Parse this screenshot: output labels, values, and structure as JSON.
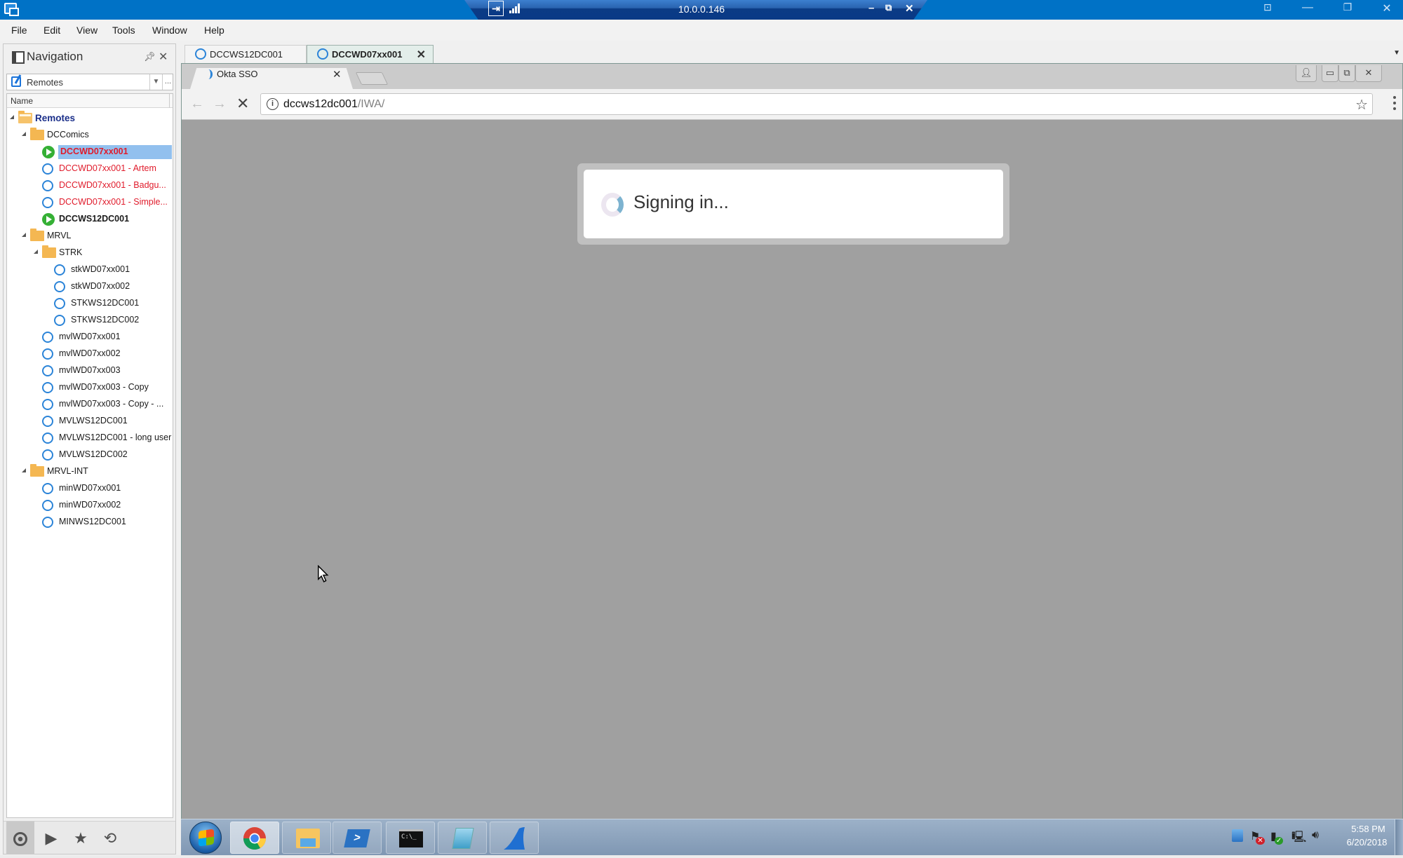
{
  "remote_bar": {
    "host": "10.0.0.146"
  },
  "menu": {
    "items": [
      "File",
      "Edit",
      "View",
      "Tools",
      "Window",
      "Help"
    ]
  },
  "navigation": {
    "title": "Navigation",
    "selector": {
      "value": "Remotes",
      "more_label": "..."
    },
    "column_header": "Name",
    "tree": [
      {
        "level": 0,
        "type": "folder",
        "label": "Remotes",
        "expanded": true,
        "style": "root"
      },
      {
        "level": 1,
        "type": "folder",
        "label": "DCComics",
        "expanded": true
      },
      {
        "level": 2,
        "type": "connected",
        "label": "DCCWD07xx001",
        "style": "red-bold",
        "selected": true
      },
      {
        "level": 2,
        "type": "remote",
        "label": "DCCWD07xx001 - Artem",
        "style": "red"
      },
      {
        "level": 2,
        "type": "remote",
        "label": "DCCWD07xx001 - Badgu...",
        "style": "red"
      },
      {
        "level": 2,
        "type": "remote",
        "label": "DCCWD07xx001 - Simple...",
        "style": "red"
      },
      {
        "level": 2,
        "type": "connected",
        "label": "DCCWS12DC001",
        "style": "bold"
      },
      {
        "level": 1,
        "type": "folder",
        "label": "MRVL",
        "expanded": true
      },
      {
        "level": 2,
        "type": "folder",
        "label": "STRK",
        "expanded": true
      },
      {
        "level": 3,
        "type": "remote",
        "label": "stkWD07xx001"
      },
      {
        "level": 3,
        "type": "remote",
        "label": "stkWD07xx002"
      },
      {
        "level": 3,
        "type": "remote",
        "label": "STKWS12DC001"
      },
      {
        "level": 3,
        "type": "remote",
        "label": "STKWS12DC002"
      },
      {
        "level": 2,
        "type": "remote",
        "label": "mvlWD07xx001"
      },
      {
        "level": 2,
        "type": "remote",
        "label": "mvlWD07xx002"
      },
      {
        "level": 2,
        "type": "remote",
        "label": "mvlWD07xx003"
      },
      {
        "level": 2,
        "type": "remote",
        "label": "mvlWD07xx003 - Copy"
      },
      {
        "level": 2,
        "type": "remote",
        "label": "mvlWD07xx003 - Copy - ..."
      },
      {
        "level": 2,
        "type": "remote",
        "label": "MVLWS12DC001"
      },
      {
        "level": 2,
        "type": "remote",
        "label": "MVLWS12DC001 - long user"
      },
      {
        "level": 2,
        "type": "remote",
        "label": "MVLWS12DC002"
      },
      {
        "level": 1,
        "type": "folder",
        "label": "MRVL-INT",
        "expanded": true
      },
      {
        "level": 2,
        "type": "remote",
        "label": "minWD07xx001"
      },
      {
        "level": 2,
        "type": "remote",
        "label": "minWD07xx002"
      },
      {
        "level": 2,
        "type": "remote",
        "label": "MINWS12DC001"
      }
    ],
    "footer_buttons": [
      "record-icon",
      "play-icon",
      "star-icon",
      "history-icon"
    ]
  },
  "document_tabs": [
    {
      "label": "DCCWS12DC001",
      "active": false
    },
    {
      "label": "DCCWD07xx001",
      "active": true,
      "close": "✕"
    }
  ],
  "browser": {
    "tab_title": "Okta SSO",
    "tab_close": "✕",
    "url_host": "dccws12dc001",
    "url_path": "/IWA/",
    "dialog_text": "Signing in..."
  },
  "taskbar": {
    "apps": [
      "chrome-icon",
      "file-explorer-icon",
      "powershell-icon",
      "command-prompt-icon",
      "notepad-icon",
      "wireshark-icon"
    ],
    "time": "5:58 PM",
    "date": "6/20/2018"
  }
}
